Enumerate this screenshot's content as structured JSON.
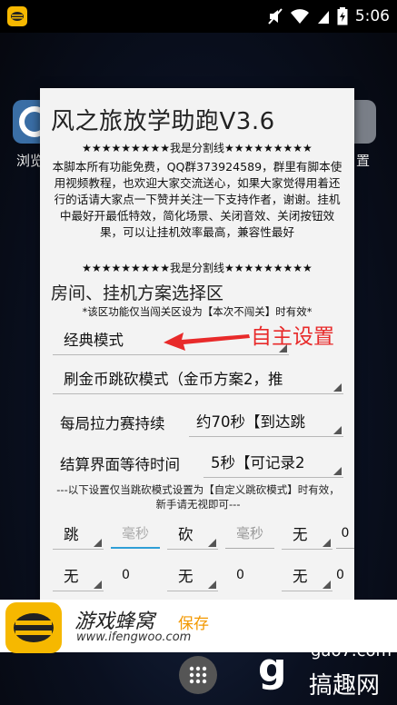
{
  "status_bar": {
    "time": "5:06"
  },
  "launcher": {
    "left_label": "浏览",
    "right_label": "置"
  },
  "dialog": {
    "title": "风之旅放学助跑V3.6",
    "divider_text": "★★★★★★★★★我是分割线★★★★★★★★★",
    "description": "本脚本所有功能免费，QQ群373924589，群里有脚本使用视频教程，也欢迎大家交流送心，如果大家觉得用着还行的话请大家点一下赞并关注一下支持作者，谢谢。挂机中最好开最低特效，简化场景、关闭音效、关闭按钮效果，可以让挂机效率最高，兼容性最好",
    "section_title": "房间、挂机方案选择区",
    "section_note": "*该区功能仅当闯关区设为【本次不闯关】时有效*",
    "mode_select": "经典模式",
    "coin_select": "刷金币跳砍模式（金币方案2，推",
    "race_label": "每局拉力赛持续",
    "race_select": "约70秒【到达跳",
    "settle_label": "结算界面等待时间",
    "settle_select": "5秒【可记录2",
    "custom_note": "---以下设置仅当跳砍模式设置为【自定义跳砍模式】时有效，新手请无视即可---",
    "row1": {
      "jump_select": "跳",
      "jump_ms_placeholder": "毫秒",
      "chop_select": "砍",
      "chop_ms_placeholder": "毫秒",
      "none_select": "无",
      "end_value": "0"
    },
    "row2": [
      {
        "select": "无",
        "value": "0"
      },
      {
        "select": "无",
        "value": "0"
      },
      {
        "select": "无",
        "value": "0"
      }
    ]
  },
  "annotation": {
    "text": "自主设置",
    "color": "#e82a2a"
  },
  "banner": {
    "brand": "游戏蜂窝",
    "url": "www.ifengwoo.com",
    "save_label": "保存",
    "save_color": "#f39800"
  },
  "watermark": {
    "logo": "g",
    "site": "gao7.com",
    "name": "搞趣网"
  },
  "colors": {
    "accent": "#2f9fd6",
    "logo_yellow": "#f6b800"
  }
}
